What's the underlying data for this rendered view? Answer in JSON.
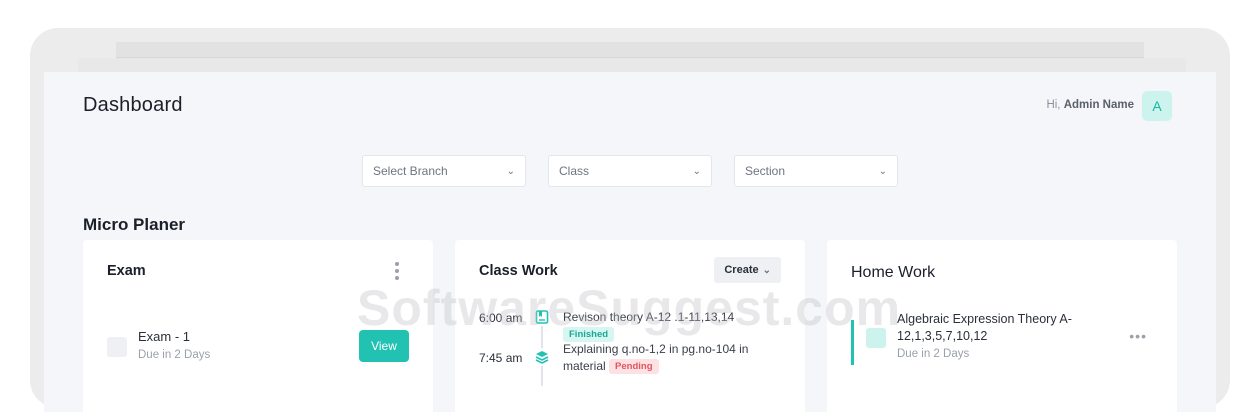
{
  "header": {
    "title": "Dashboard",
    "greeting_prefix": "Hi,",
    "user_name": "Admin Name",
    "avatar_letter": "A"
  },
  "filters": {
    "branch": "Select Branch",
    "class": "Class",
    "section": "Section"
  },
  "section_title": "Micro Planer",
  "exam": {
    "title": "Exam",
    "item_title": "Exam - 1",
    "item_due": "Due in 2 Days",
    "view_label": "View"
  },
  "classwork": {
    "title": "Class Work",
    "create_label": "Create",
    "entries": [
      {
        "time": "6:00 am",
        "text": "Revison theory A-12 .1-11,13,14",
        "status": "Finished",
        "icon": "book-icon"
      },
      {
        "time": "7:45 am",
        "text": "Explaining q.no-1,2 in pg.no-104 in material",
        "status": "Pending",
        "icon": "layers-icon"
      }
    ]
  },
  "homework": {
    "title": "Home Work",
    "item_title": "Algebraic Expression Theory A-12,1,3,5,7,10,12",
    "item_due": "Due in 2 Days"
  },
  "watermark": "SoftwareSuggest.com",
  "colors": {
    "accent": "#22c2b3",
    "accent_light": "#cdf3ef",
    "pending": "#e0555f",
    "background": "#f4f6f9"
  }
}
